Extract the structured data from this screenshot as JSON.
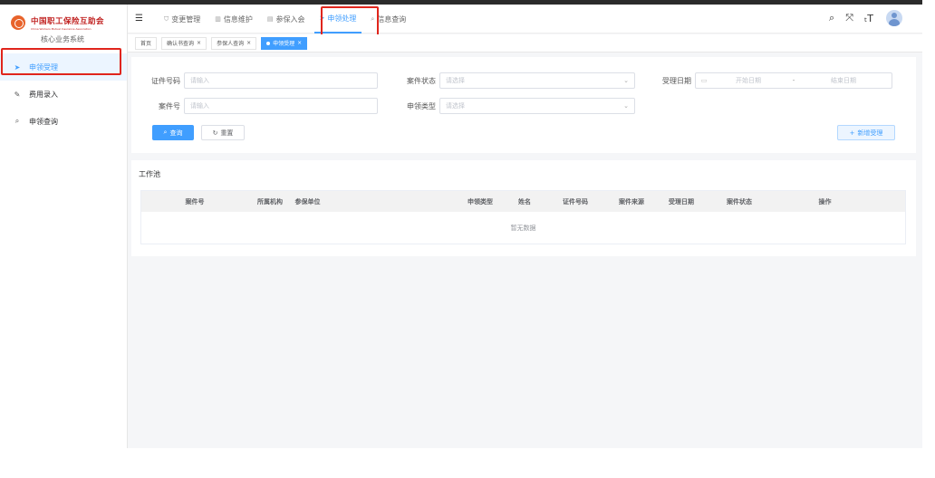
{
  "sidebar": {
    "logo_cn": "中国职工保险互助会",
    "logo_en": "China Workers Mutual Insurance Association",
    "system_name": "核心业务系统",
    "items": [
      {
        "label": "申领受理",
        "icon": "send-icon"
      },
      {
        "label": "费用录入",
        "icon": "edit-icon"
      },
      {
        "label": "申领查询",
        "icon": "search-icon"
      }
    ]
  },
  "navbar": {
    "items": [
      {
        "label": "变更管理",
        "icon": "shield-icon"
      },
      {
        "label": "信息维护",
        "icon": "chart-icon"
      },
      {
        "label": "参保入会",
        "icon": "document-icon"
      },
      {
        "label": "申领处理",
        "icon": "send-icon"
      },
      {
        "label": "信息查询",
        "icon": "search-icon"
      }
    ]
  },
  "tags": [
    {
      "label": "首页"
    },
    {
      "label": "确认书查询"
    },
    {
      "label": "参保人查询"
    },
    {
      "label": "申领受理"
    }
  ],
  "search": {
    "cert_no_label": "证件号码",
    "cert_no_placeholder": "请输入",
    "case_status_label": "案件状态",
    "case_status_placeholder": "请选择",
    "accept_date_label": "受理日期",
    "start_date_placeholder": "开始日期",
    "date_separator": "-",
    "end_date_placeholder": "结束日期",
    "case_no_label": "案件号",
    "case_no_placeholder": "请输入",
    "claim_type_label": "申领类型",
    "claim_type_placeholder": "请选择",
    "query_button": "查询",
    "reset_button": "重置",
    "add_button": "新增受理"
  },
  "pool": {
    "title": "工作池",
    "columns": [
      "案件号",
      "所属机构",
      "参保单位",
      "申领类型",
      "姓名",
      "证件号码",
      "案件来源",
      "受理日期",
      "案件状态",
      "操作"
    ],
    "empty_text": "暂无数据"
  },
  "colors": {
    "accent": "#409eff",
    "highlight_box": "#e0251c",
    "logo_red": "#c0201f"
  }
}
